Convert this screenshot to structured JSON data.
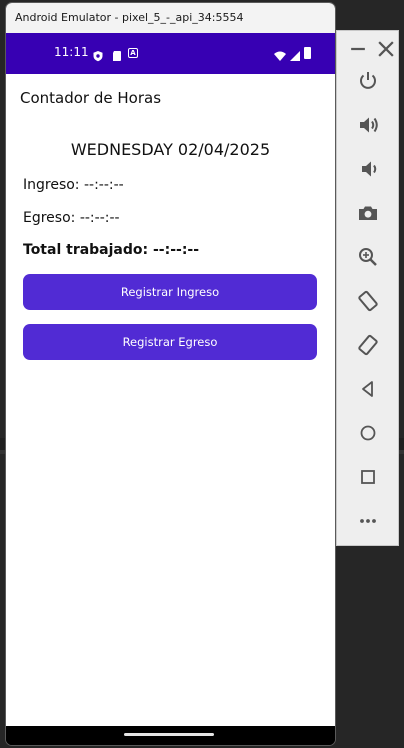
{
  "window": {
    "title": "Android Emulator - pixel_5_-_api_34:5554"
  },
  "status_bar": {
    "time": "11:11"
  },
  "app": {
    "title": "Contador de Horas",
    "date": "WEDNESDAY 02/04/2025",
    "ingreso": "Ingreso: --:--:--",
    "egreso": "Egreso: --:--:--",
    "total": "Total trabajado: --:--:--",
    "btn_ingreso": "Registrar Ingreso",
    "btn_egreso": "Registrar Egreso"
  },
  "toolbar": {
    "items": [
      "minimize-icon",
      "close-icon",
      "power-icon",
      "volume-up-icon",
      "volume-down-icon",
      "camera-icon",
      "zoom-icon",
      "rotate-left-icon",
      "rotate-right-icon",
      "back-icon",
      "home-icon",
      "overview-icon",
      "more-icon"
    ]
  },
  "colors": {
    "status_bar": "#3700b3",
    "button": "#512bd4",
    "toolbar_icon": "#555555"
  }
}
